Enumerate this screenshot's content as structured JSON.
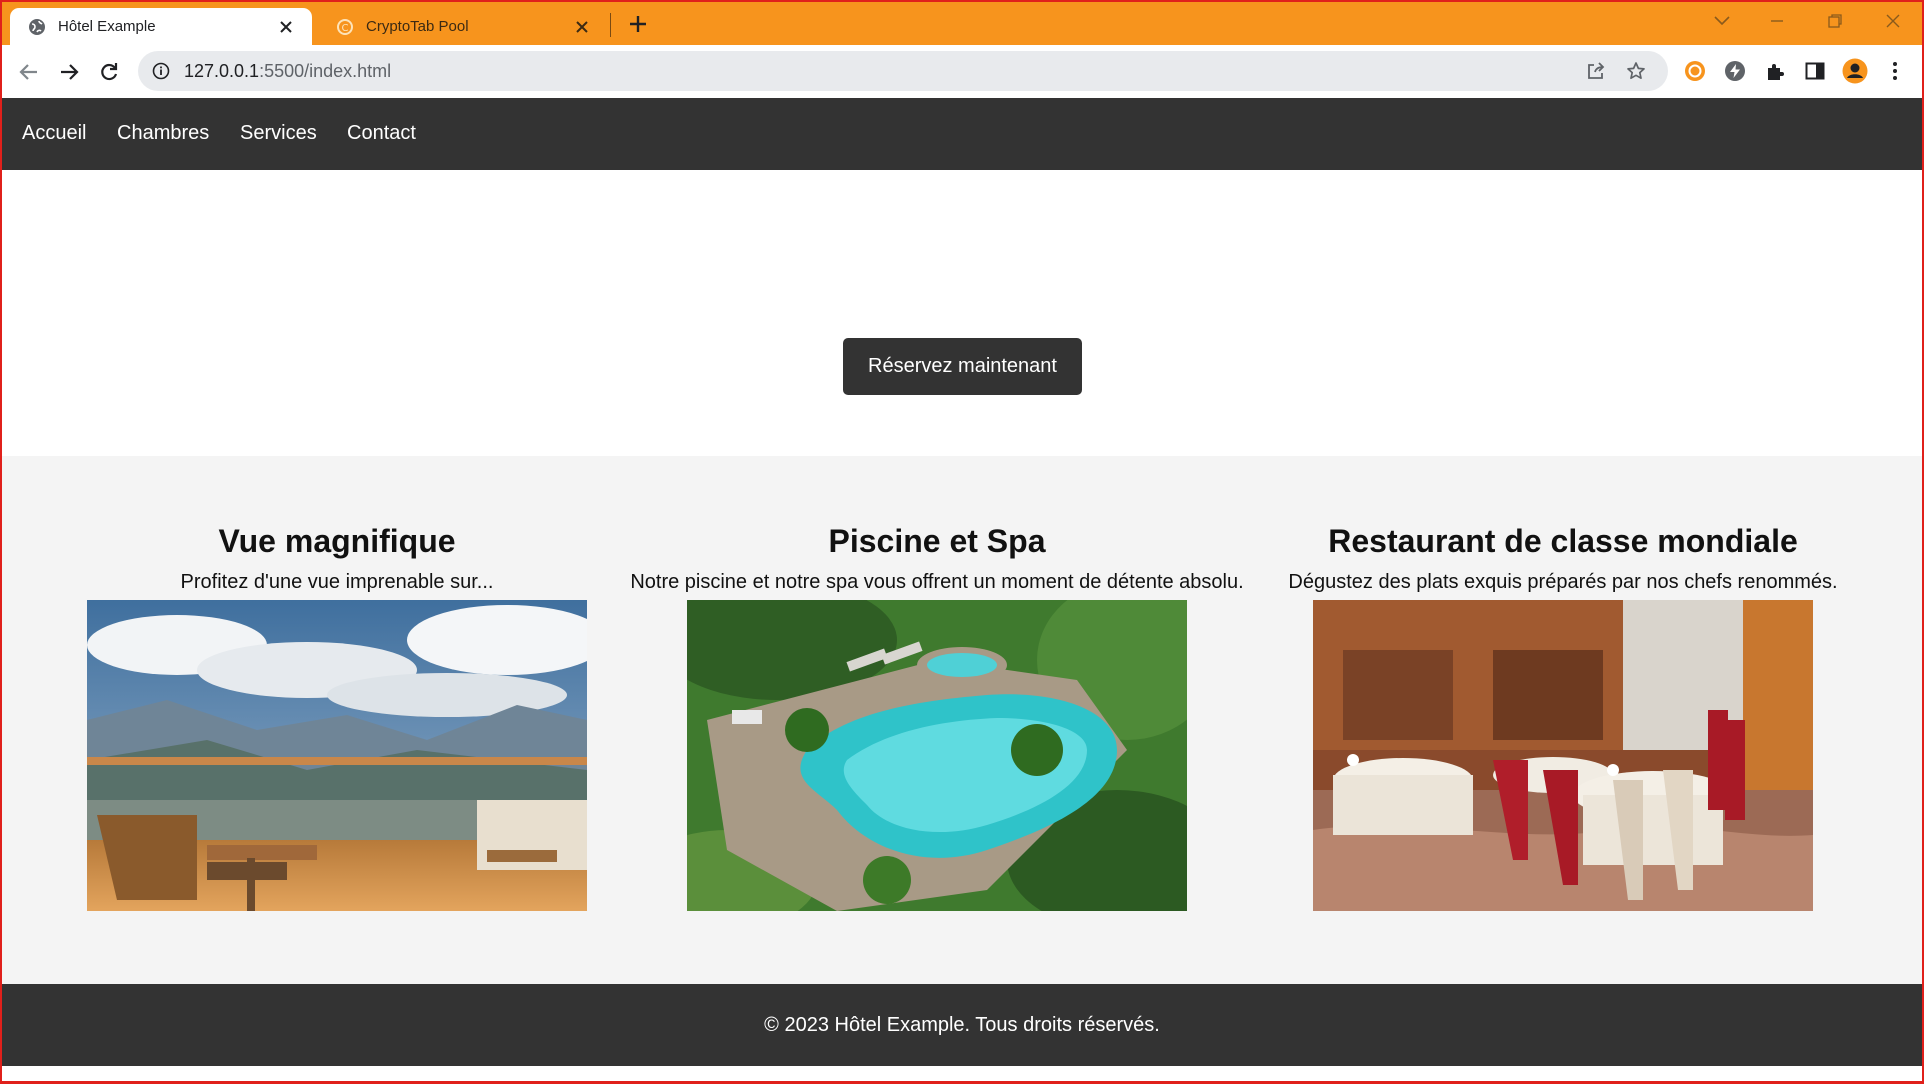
{
  "browser": {
    "tabs": [
      {
        "title": "Hôtel Example",
        "active": true
      },
      {
        "title": "CryptoTab Pool",
        "active": false
      }
    ],
    "url_host": "127.0.0.1",
    "url_rest": ":5500/index.html",
    "accent_color": "#f7941d"
  },
  "nav": {
    "items": [
      "Accueil",
      "Chambres",
      "Services",
      "Contact"
    ]
  },
  "hero": {
    "cta_label": "Réservez maintenant"
  },
  "features": [
    {
      "title": "Vue magnifique",
      "text": "Profitez d'une vue imprenable sur...",
      "image": "balcony-mountain-view-photo"
    },
    {
      "title": "Piscine et Spa",
      "text": "Notre piscine et notre spa vous offrent un moment de détente absolu.",
      "image": "pool-garden-photo"
    },
    {
      "title": "Restaurant de classe mondiale",
      "text": "Dégustez des plats exquis préparés par nos chefs renommés.",
      "image": "restaurant-interior-photo"
    }
  ],
  "footer": {
    "text": "© 2023 Hôtel Example. Tous droits réservés."
  },
  "colors": {
    "nav_bg": "#333333",
    "features_bg": "#f4f4f4",
    "window_border": "#e0201b"
  }
}
